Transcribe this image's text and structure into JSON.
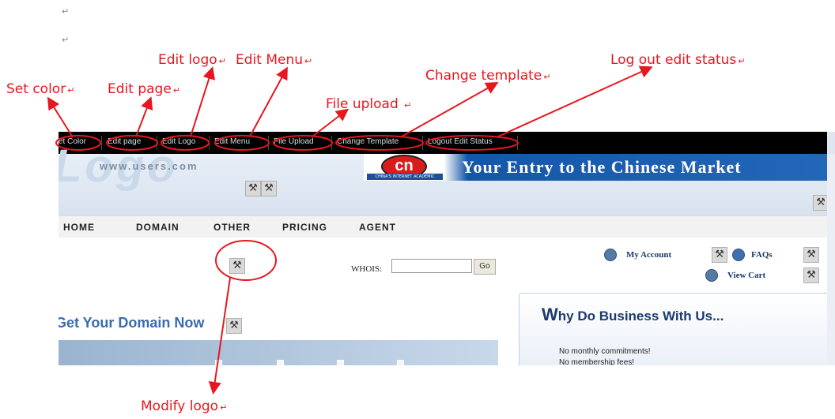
{
  "doc": {
    "para_mark": "↵"
  },
  "annotations": {
    "set_color": "Set color",
    "edit_page": "Edit page",
    "edit_logo": "Edit logo",
    "edit_menu": "Edit Menu",
    "file_upload": "File upload",
    "change_template": "Change template",
    "logout_edit_status": "Log out edit status",
    "modify_logo": "Modify logo",
    "edit_menu_mark": "↩"
  },
  "toolbar": {
    "items": [
      "et Color",
      "Edit page",
      "Edit Logo",
      "Edit Menu",
      "File Upload",
      "Change Template",
      "Logout Edit Status"
    ]
  },
  "header": {
    "logo_url": "www.users.com",
    "cn_badge": "cn",
    "cn_sub": "CHINA'S INTERNET ACADEMIC",
    "banner_title": "Your Entry to the Chinese Market",
    "tool_glyph": "⚒"
  },
  "nav": {
    "items": [
      "HOME",
      "DOMAIN",
      "OTHER",
      "PRICING",
      "AGENT"
    ]
  },
  "whois": {
    "label": "WHOIS:",
    "value": "",
    "go_label": "Go"
  },
  "account": {
    "my_account": "My Account",
    "faqs": "FAQs",
    "view_cart": "View Cart"
  },
  "domain": {
    "title": "Get Your Domain Now"
  },
  "why": {
    "title_w": "W",
    "title_rest": "hy Do Business With Us...",
    "lines": [
      "No monthly commitments!",
      "No membership fees!"
    ]
  },
  "colors": {
    "annotation": "#e8161e",
    "banner_blue": "#1456a8",
    "toolbar_bg": "#000000"
  }
}
